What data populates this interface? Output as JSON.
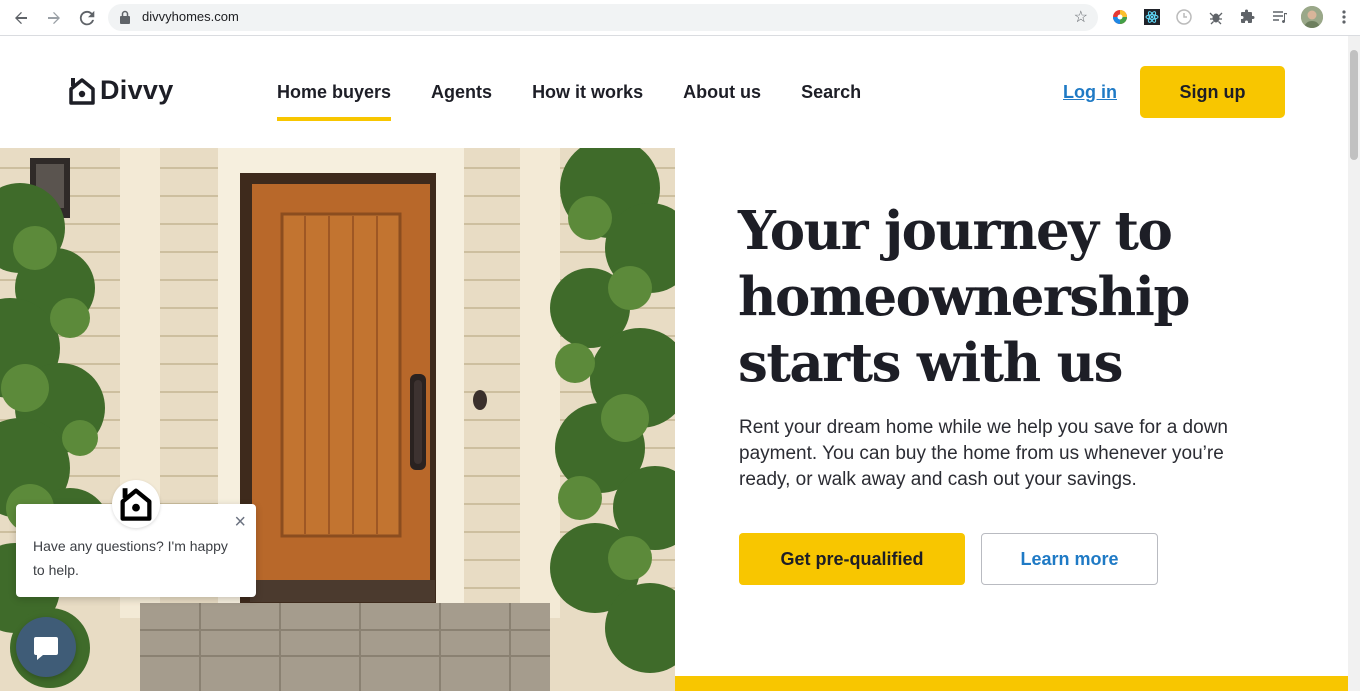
{
  "browser": {
    "url": "divvyhomes.com",
    "back_icon": "arrow-left-icon",
    "forward_icon": "arrow-right-icon",
    "reload_icon": "reload-icon",
    "star_icon": "star-icon"
  },
  "header": {
    "logo_text": "Divvy",
    "nav": [
      {
        "label": "Home buyers",
        "active": true
      },
      {
        "label": "Agents"
      },
      {
        "label": "How it works"
      },
      {
        "label": "About us"
      },
      {
        "label": "Search"
      }
    ],
    "login_label": "Log in",
    "signup_label": "Sign up"
  },
  "hero": {
    "headline_line1": "Your journey to",
    "headline_line2": "homeownership",
    "headline_line3": "starts with us",
    "subtext": "Rent your dream home while we help you save for a down payment. You can buy the home from us whenever you’re ready, or walk away and cash out your savings.",
    "primary_cta": "Get pre-qualified",
    "secondary_cta": "Learn more"
  },
  "chat": {
    "message": "Have any questions? I'm happy to help."
  },
  "colors": {
    "brand_yellow": "#f8c600",
    "link_blue": "#1f7ac5",
    "text_dark": "#1d1e26",
    "chat_blue": "#3f5c77"
  }
}
